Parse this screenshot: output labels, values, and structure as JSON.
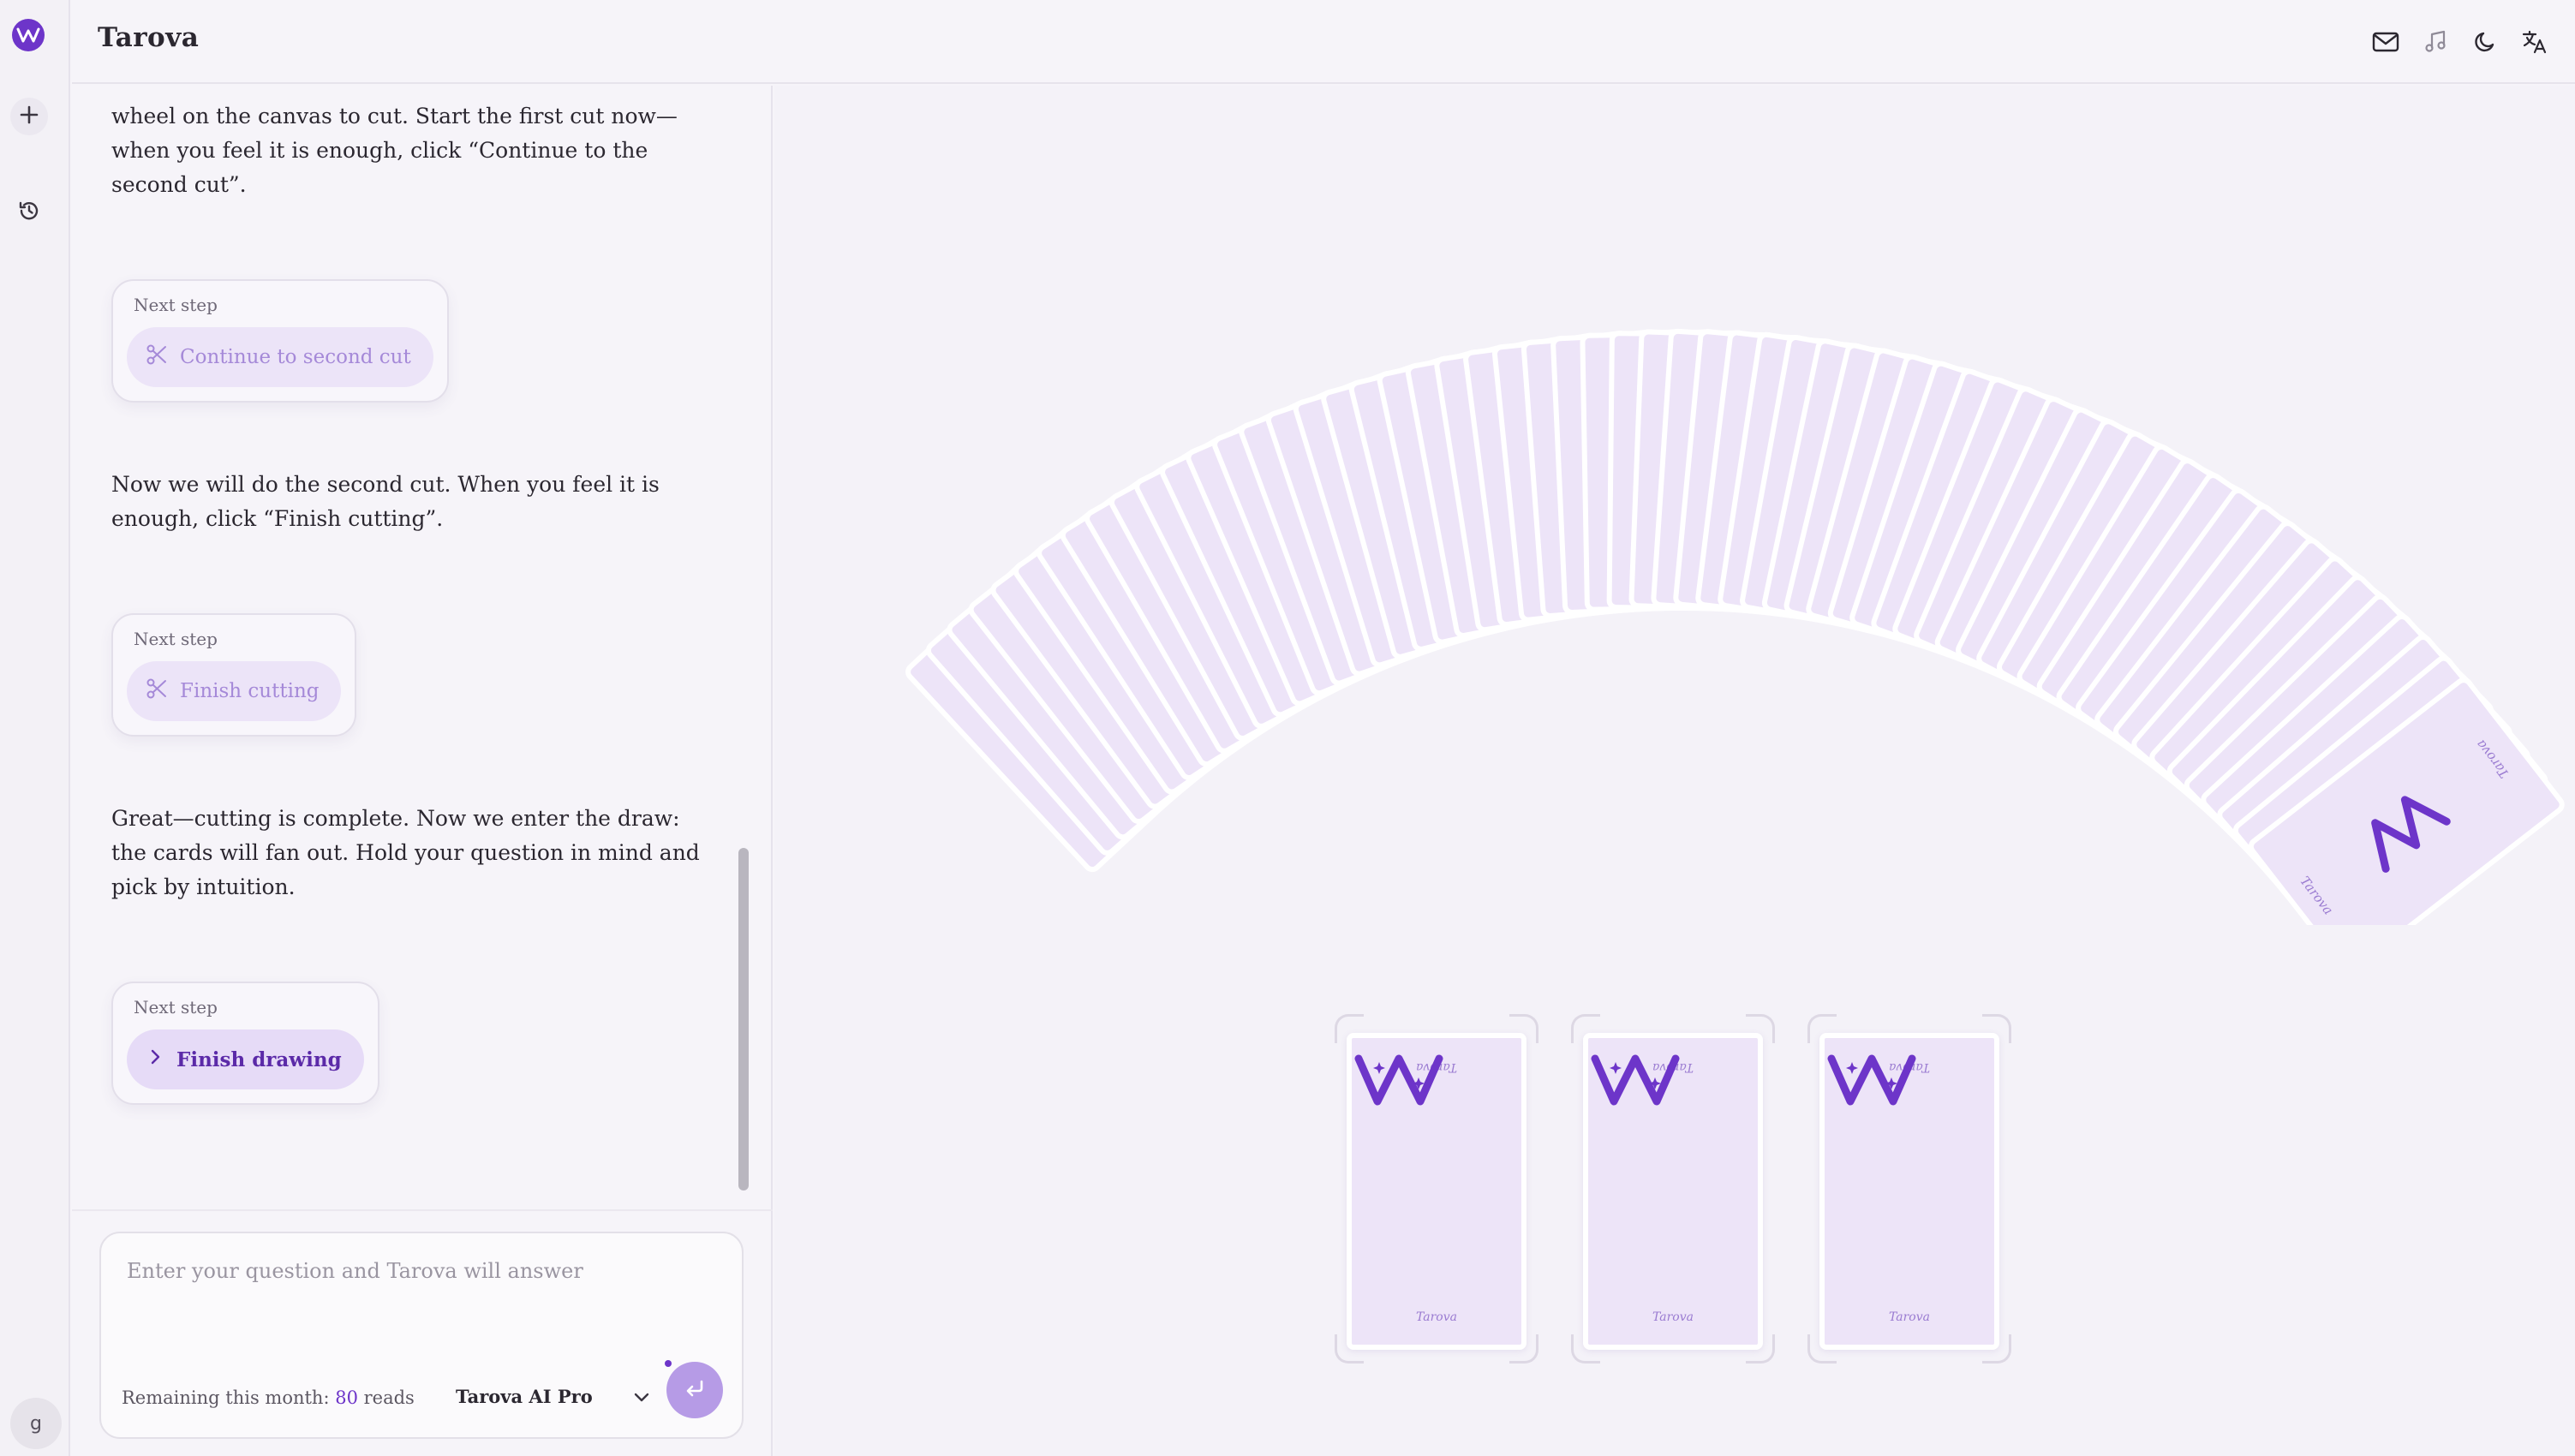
{
  "app": {
    "title": "Tarova",
    "avatar_initial": "g"
  },
  "header": {
    "icons": [
      "mail-icon",
      "music-icon",
      "moon-icon",
      "translate-icon"
    ]
  },
  "rail": {
    "icons": [
      "logo-icon",
      "plus-icon",
      "history-icon"
    ]
  },
  "chat": {
    "messages": [
      {
        "text": "wheel on the canvas to cut. Start the first cut now—when you feel it is enough, click “Continue to the second cut”."
      },
      {
        "step_label": "Next step",
        "button": "Continue to second cut",
        "icon": "scissors-icon",
        "state": "disabled"
      },
      {
        "text": "Now we will do the second cut. When you feel it is enough, click “Finish cutting”."
      },
      {
        "step_label": "Next step",
        "button": "Finish cutting",
        "icon": "scissors-icon",
        "state": "disabled"
      },
      {
        "text": "Great—cutting is complete. Now we enter the draw: the cards will fan out. Hold your question in mind and pick by intuition."
      },
      {
        "step_label": "Next step",
        "button": "Finish drawing",
        "icon": "chevron-right-icon",
        "state": "active"
      }
    ]
  },
  "composer": {
    "placeholder": "Enter your question and Tarova will answer",
    "value": "",
    "quota_prefix": "Remaining this month: ",
    "quota_count": "80",
    "quota_suffix": " reads",
    "model": "Tarova AI Pro"
  },
  "canvas": {
    "fan_card_count": 60,
    "selected_slot_count": 3,
    "card_brand": "Tarova",
    "colors": {
      "accent": "#6d35c9",
      "card_fill": "#ede4f8",
      "card_border": "#ffffff"
    }
  }
}
